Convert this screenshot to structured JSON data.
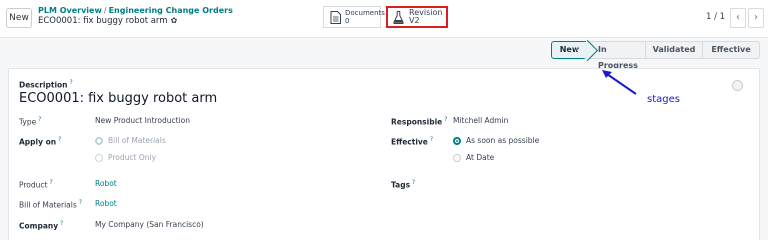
{
  "topbar": {
    "new_label": "New",
    "breadcrumb": [
      "PLM Overview",
      "Engineering Change Orders"
    ],
    "breadcrumb_sep": "/",
    "record_title": "ECO0001: fix buggy robot arm",
    "smart_buttons": [
      {
        "label": "Documents",
        "value": "0"
      },
      {
        "label": "Revision",
        "value": "V2"
      }
    ],
    "pager": "1 / 1",
    "prev_icon": "‹",
    "next_icon": "›"
  },
  "statusbar": {
    "stages": [
      "New",
      "In Progress",
      "Validated",
      "Effective"
    ],
    "active": "New"
  },
  "annotation": {
    "text": "stages"
  },
  "form": {
    "description_label": "Description",
    "title": "ECO0001: fix buggy robot arm",
    "tooltip_mark": "?",
    "type": {
      "label": "Type",
      "value": "New Product Introduction"
    },
    "apply_on": {
      "label": "Apply on",
      "options": [
        "Bill of Materials",
        "Product Only"
      ],
      "selected": "Bill of Materials"
    },
    "responsible": {
      "label": "Responsible",
      "value": "Mitchell Admin"
    },
    "effective": {
      "label": "Effective",
      "options": [
        "As soon as possible",
        "At Date"
      ],
      "selected": "As soon as possible"
    },
    "product": {
      "label": "Product",
      "value": "Robot"
    },
    "bill_of_materials": {
      "label": "Bill of Materials",
      "value": "Robot"
    },
    "tags": {
      "label": "Tags",
      "value": ""
    },
    "company": {
      "label": "Company",
      "value": "My Company (San Francisco)"
    }
  },
  "colors": {
    "accent": "#017e84",
    "highlight_border": "#d82020",
    "annotation": "#1a1acd"
  }
}
